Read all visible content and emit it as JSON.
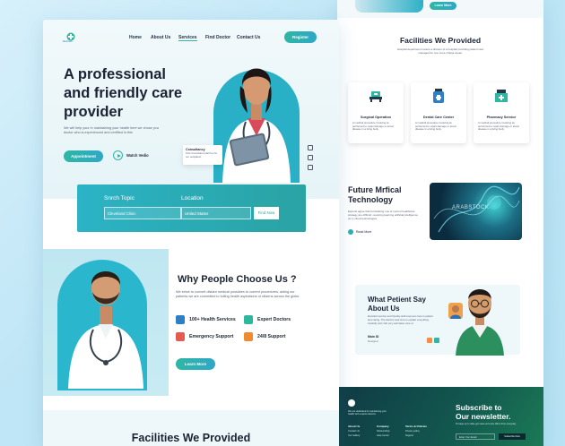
{
  "nav": {
    "logo_text": "MedCare",
    "items": [
      "Home",
      "About Us",
      "Services",
      "Find Doctor",
      "Contact Us"
    ],
    "register": "Register"
  },
  "hero": {
    "title_line1": "A professional",
    "title_line2": "and friendly care",
    "title_line3": "provider",
    "subtitle": "We will help your in maintaining your health here we chose you doctor who is experienced and certified in this",
    "appointment": "Appointment",
    "watch": "Watch Vedio",
    "consult_title": "Consultancy",
    "consult_text": "First Consultant total free for our outpatient"
  },
  "search": {
    "topic_label": "Snrch Topic",
    "location_label": "Location",
    "topic_value": "Cleveland Clinic",
    "location_value": "United States",
    "button": "Find Now"
  },
  "why": {
    "title": "Why People Choose Us ?",
    "text": "We strive to convert distant medical possibles to current procedures, aiding our patients we are committed to fulfing health aspirations of citizens across the globe.",
    "features": [
      "100+ Health Services",
      "Expert Doctors",
      "Emergency Support",
      "24/8 Support"
    ],
    "button": "Learn More"
  },
  "left_bottom_title": "Facilities We Provided",
  "right": {
    "top_button": "Learn More",
    "facilities_title": "Facilities We Provided",
    "facilities_sub": "Hospital department means a division of a hospital providing patient care managed for one more charge areas.",
    "facilities": [
      {
        "name": "Surgical Operation",
        "text": "A medical procedure involving an performed to repair damage or arrest disease in a living body."
      },
      {
        "name": "Dental Care Center",
        "text": "A medical procedure involving an performed to repair damage or arrest disease in a living body."
      },
      {
        "name": "Pharmacy Service",
        "text": "A medical procedure involving an performed to repair damage or arrest disease in a living body."
      }
    ],
    "future_title_line1": "Future Mrfical",
    "future_title_line2": "Technology",
    "future_text": "Experts agree that formulating one of current healthcare strategy are difficult: resolving learning artificial intelligence (A.I.) cloud technologies.",
    "future_link": "Read More",
    "future_image_caption": "ARABSTOCK",
    "testimonial_title_line1": "What Petient Say",
    "testimonial_title_line2": "About Us",
    "testimonial_text": "Excellent service and friendly staff everyone here is patient and caring. The doctors took time to explain everything carefully and I felt very well taken care of.",
    "testimonial_name": "Main ID",
    "testimonial_role": "Designer",
    "footer_cols": [
      {
        "title": "About Us",
        "links": [
          "Contact Us",
          "Our Gallery"
        ]
      },
      {
        "title": "Company",
        "links": [
          "Partnerships",
          "Help Center"
        ]
      },
      {
        "title": "Terms & Policies",
        "links": [
          "Privacy policy",
          "Support"
        ]
      }
    ],
    "footer_brand_text": "We are dedicated to maintaining your health with experts doctors.",
    "newsletter_line1": "Subscribe to",
    "newsletter_line2": "Our newsletter.",
    "newsletter_sub": "To keep up to date get news and new offers from everyday",
    "newsletter_placeholder": "Enter Your Email",
    "newsletter_button": "Subscribe Now"
  },
  "colors": {
    "teal": "#2eb7a3",
    "blue": "#2fa7c7",
    "dark": "#1a2233"
  }
}
